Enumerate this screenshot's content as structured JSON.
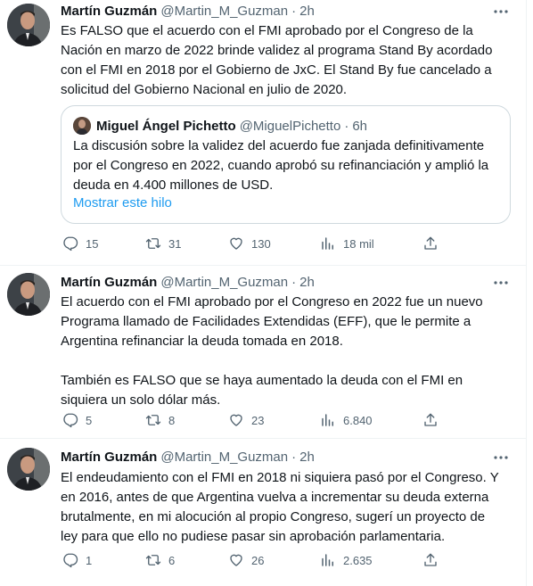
{
  "tweets": [
    {
      "name": "Martín Guzmán",
      "handle": "@Martin_M_Guzman",
      "dot": "·",
      "time": "2h",
      "text": "Es FALSO que el acuerdo con el FMI aprobado por el Congreso de la\nNación en marzo de 2022 brinde validez al programa Stand By acordado\ncon el FMI en 2018 por el Gobierno de JxC. El Stand By fue cancelado a\nsolicitud del Gobierno Nacional en julio de 2020.",
      "quote": {
        "name": "Miguel Ángel Pichetto",
        "handle": "@MiguelPichetto",
        "dot": "·",
        "time": "6h",
        "text": "La discusión sobre la validez del acuerdo fue zanjada definitivamente\npor el Congreso en 2022, cuando aprobó su refinanciación y amplió la\ndeuda en 4.400 millones de USD.",
        "show_thread": "Mostrar este hilo"
      },
      "counts": {
        "replies": "15",
        "retweets": "31",
        "likes": "130",
        "views": "18 mil"
      }
    },
    {
      "name": "Martín Guzmán",
      "handle": "@Martin_M_Guzman",
      "dot": "·",
      "time": "2h",
      "text": "El acuerdo con el FMI aprobado por el Congreso en 2022 fue un nuevo\nPrograma llamado de Facilidades Extendidas (EFF), que le permite a\nArgentina refinanciar la deuda tomada en 2018.\n\nTambién es FALSO que se haya aumentado la deuda con el FMI en\nsiquiera un solo dólar más.",
      "counts": {
        "replies": "5",
        "retweets": "8",
        "likes": "23",
        "views": "6.840"
      }
    },
    {
      "name": "Martín Guzmán",
      "handle": "@Martin_M_Guzman",
      "dot": "·",
      "time": "2h",
      "text": "El endeudamiento con el FMI en 2018 ni siquiera pasó por el Congreso. Y\nen 2016, antes de que Argentina vuelva a incrementar su deuda externa\nbrutalmente, en mi alocución al propio Congreso, sugerí un proyecto de\nley para que ello no pudiese pasar sin aprobación parlamentaria.",
      "counts": {
        "replies": "1",
        "retweets": "6",
        "likes": "26",
        "views": "2.635"
      }
    }
  ],
  "icons": {
    "avatar": "profile-photo",
    "more": "more-icon",
    "reply": "reply-icon",
    "retweet": "retweet-icon",
    "like": "heart-icon",
    "views": "views-icon",
    "share": "share-icon"
  },
  "colors": {
    "link": "#1d9bf0",
    "secondary": "#536471",
    "text": "#0f1419",
    "border": "#cfd9de"
  }
}
